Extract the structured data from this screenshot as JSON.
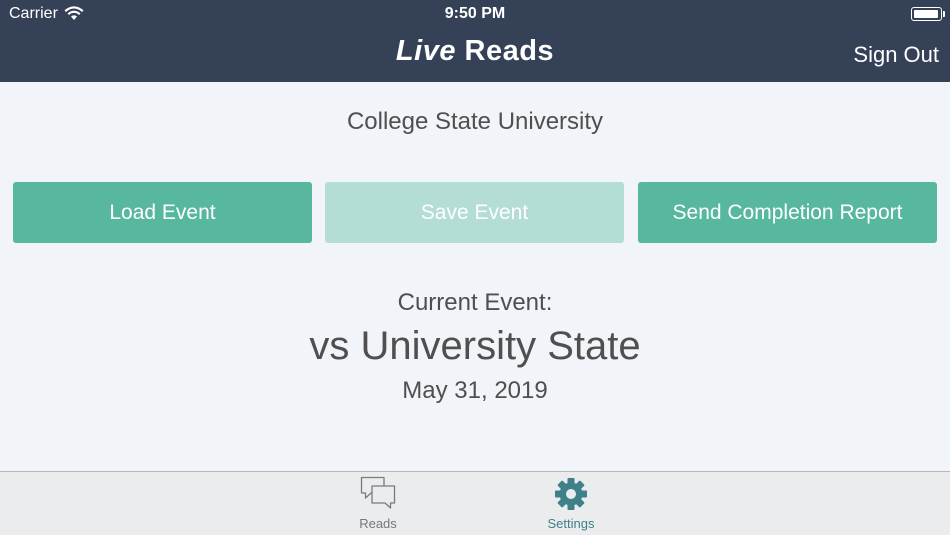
{
  "status_bar": {
    "carrier": "Carrier",
    "time": "9:50 PM"
  },
  "header": {
    "title_italic": "Live",
    "title_rest": "Reads",
    "sign_out": "Sign Out"
  },
  "institution": "College State University",
  "actions": {
    "load": "Load Event",
    "save": "Save Event",
    "report": "Send Completion Report"
  },
  "current_event": {
    "label": "Current Event:",
    "name": "vs University State",
    "date": "May 31, 2019"
  },
  "tabs": [
    {
      "label": "Reads",
      "icon": "chat-bubbles-icon"
    },
    {
      "label": "Settings",
      "icon": "gear-icon",
      "selected": true
    }
  ],
  "colors": {
    "header_bg": "#354156",
    "button_green": "#57b79f",
    "button_disabled": "#b3ddd5",
    "settings_active": "#3f8089"
  }
}
